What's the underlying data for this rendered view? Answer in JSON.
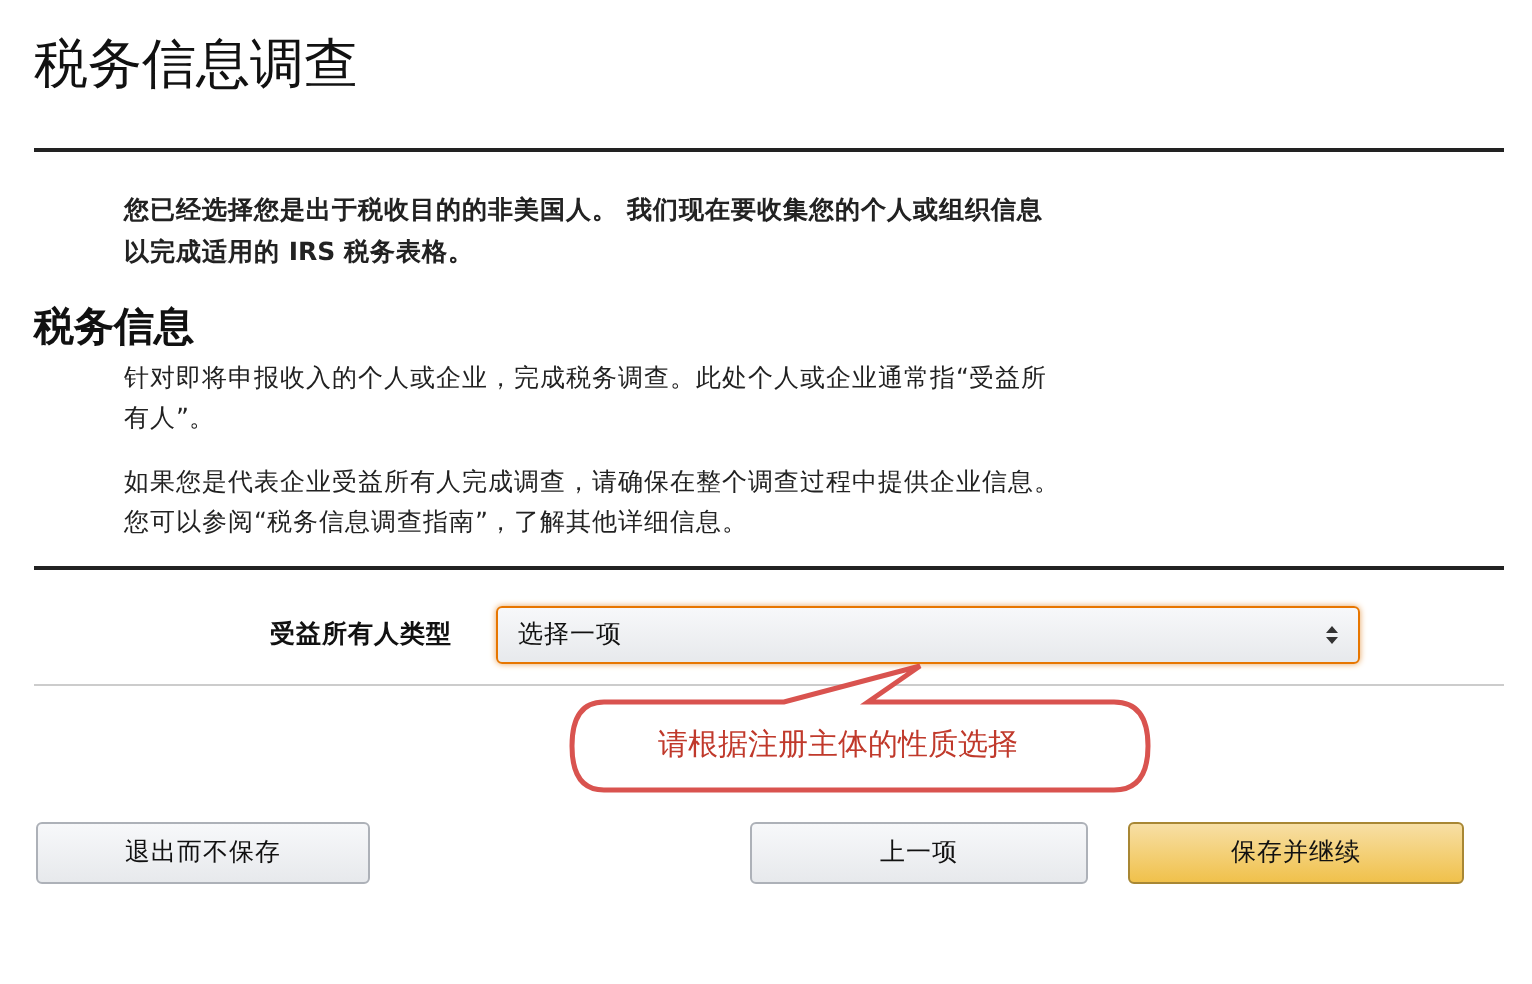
{
  "title": "税务信息调查",
  "intro": "您已经选择您是出于税收目的的非美国人。 我们现在要收集您的个人或组织信息以完成适用的 IRS 税务表格。",
  "section": {
    "heading": "税务信息",
    "paragraphs": [
      "针对即将申报收入的个人或企业，完成税务调查。此处个人或企业通常指“受益所有人”。",
      "如果您是代表企业受益所有人完成调查，请确保在整个调查过程中提供企业信息。您可以参阅“税务信息调查指南”，了解其他详细信息。"
    ]
  },
  "field": {
    "label": "受益所有人类型",
    "value": "选择一项"
  },
  "callout": "请根据注册主体的性质选择",
  "buttons": [
    {
      "label": "退出而不保存",
      "kind": "secondary"
    },
    {
      "label": "上一项",
      "kind": "secondary"
    },
    {
      "label": "保存并继续",
      "kind": "primary"
    }
  ]
}
